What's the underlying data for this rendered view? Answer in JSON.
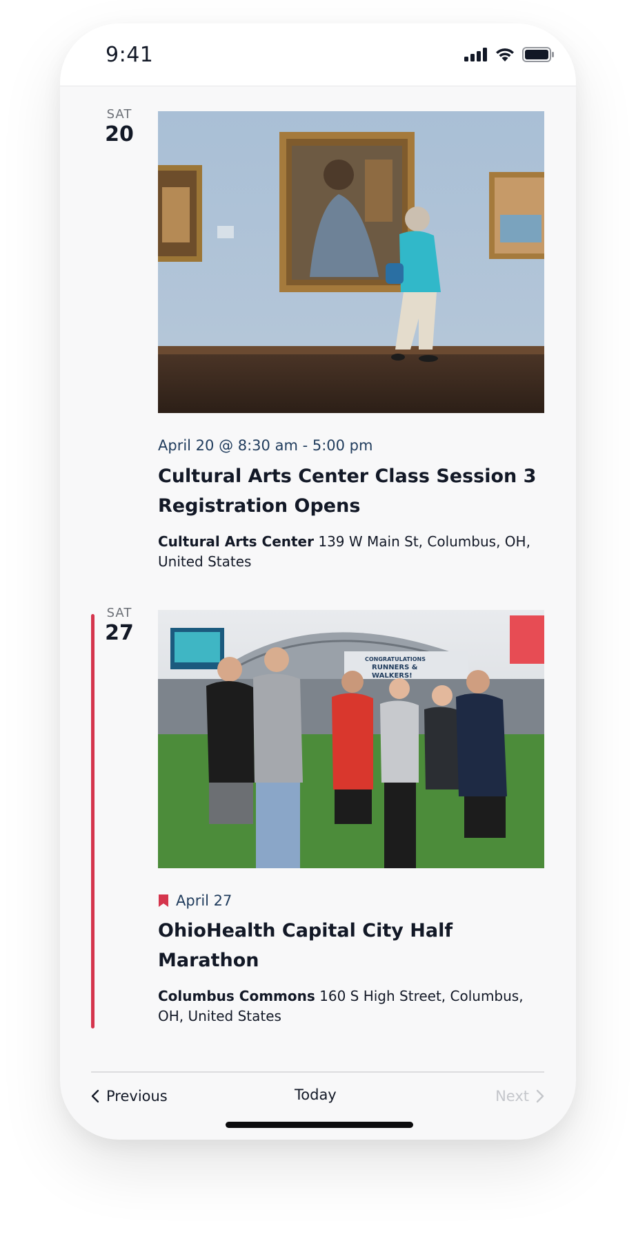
{
  "status_bar": {
    "time": "9:41",
    "signal_icon": "cellular-signal-icon",
    "wifi_icon": "wifi-icon",
    "battery_icon": "battery-icon"
  },
  "events": [
    {
      "day_of_week": "SAT",
      "day_number": "20",
      "date_text": "April 20 @ 8:30 am - 5:00 pm",
      "title": "Cultural Arts Center Class Session 3 Registration Opens",
      "venue_name": "Cultural Arts Center",
      "venue_address": " 139 W Main St, Columbus, OH, United States",
      "image_subject": "museum gallery photo"
    },
    {
      "day_of_week": "SAT",
      "day_number": "27",
      "featured": true,
      "featured_icon": "bookmark-icon",
      "date_text": "April 27",
      "title": "OhioHealth Capital City Half Marathon",
      "venue_name": "Columbus Commons",
      "venue_address": " 160 S High Street, Columbus, OH, United States",
      "image_subject": "marathon runners celebrating photo",
      "image_signs": {
        "banner_line1": "CONGRATULATIONS",
        "banner_line2": "RUNNERS &",
        "banner_line3": "WALKERS!"
      }
    }
  ],
  "navigation": {
    "previous": "Previous",
    "today": "Today",
    "next": "Next"
  },
  "colors": {
    "accent_red": "#d5354d",
    "date_blue": "#1f3b5c",
    "text_dark": "#121826",
    "muted": "#c4c6cb"
  }
}
